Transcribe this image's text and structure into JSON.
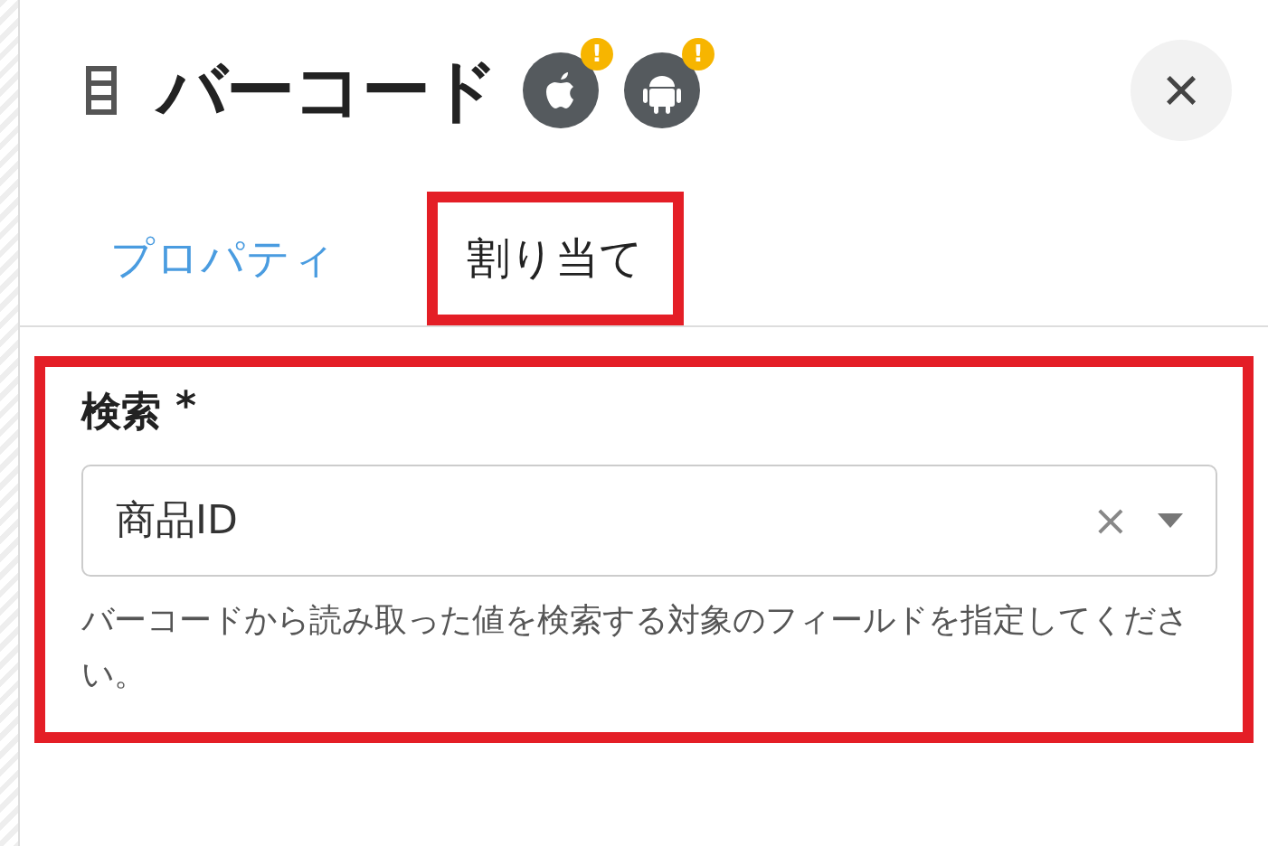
{
  "panel": {
    "title": "バーコード",
    "platform_badges": [
      {
        "kind": "apple",
        "warning": "!"
      },
      {
        "kind": "android",
        "warning": "!"
      }
    ],
    "close": "×"
  },
  "tabs": [
    {
      "label": "プロパティ",
      "selected": false,
      "highlighted": false
    },
    {
      "label": "割り当て",
      "selected": true,
      "highlighted": true
    }
  ],
  "field": {
    "label": "検索",
    "required": "*",
    "value": "商品ID",
    "clear": "×",
    "help": "バーコードから読み取った値を検索する対象のフィールドを指定してください。",
    "highlighted": true
  }
}
